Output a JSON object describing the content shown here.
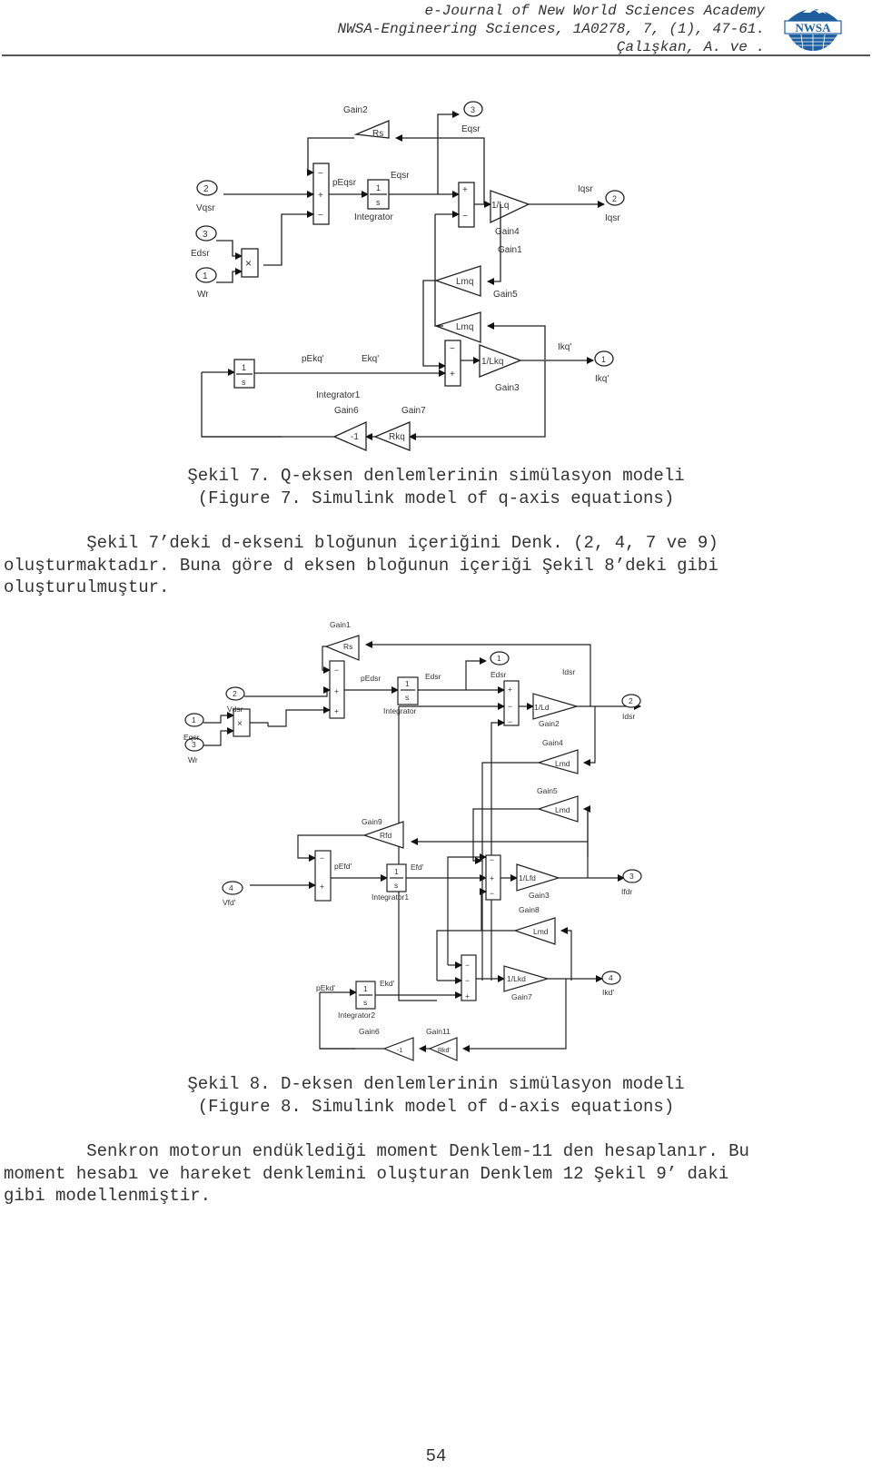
{
  "header": {
    "journal": "e-Journal of New World Sciences Academy",
    "citation": "NWSA-Engineering Sciences, 1A0278, 7, (1), 47-61.",
    "authors": "Çalışkan, A. ve .",
    "logo_text": "NWSA"
  },
  "figure7": {
    "caption_tr": "Şekil 7. Q-eksen denlemlerinin simülasyon modeli",
    "caption_en": "(Figure 7. Simulink model of q-axis equations)",
    "labels": {
      "gain2": "Gain2",
      "rs": "Rs",
      "in2_num": "2",
      "in2": "Vqsr",
      "in3_num": "3",
      "in3": "Edsr",
      "in1_num": "1",
      "in1": "Wr",
      "product": "×",
      "pEqsr": "pEqsr",
      "eqsr": "Eqsr",
      "int_num": "1",
      "int_den": "s",
      "integrator": "Integrator",
      "out3_num": "3",
      "out3": "Eqsr",
      "gain4_val": "1/Lq",
      "gain4": "Gain4",
      "iqsr": "Iqsr",
      "out2_num": "2",
      "out2": "Iqsr",
      "gain1": "Gain1",
      "lmq1": "Lmq",
      "gain5": "Gain5",
      "lmq2": "Lmq",
      "pEkq": "pEkq'",
      "ekq": "Ekq'",
      "integrator1": "Integrator1",
      "gain3_val": "1/Lkq",
      "gain3": "Gain3",
      "ikq": "Ikq'",
      "out1_num": "1",
      "out1": "Ikq'",
      "gain6": "Gain6",
      "neg1": "-1",
      "gain7": "Gain7",
      "rkq": "Rkq",
      "plus": "+",
      "minus": "−"
    }
  },
  "paragraph1": "        Şekil 7’deki d-ekseni bloğunun içeriğini Denk. (2, 4, 7 ve 9)\noluşturmaktadır. Buna göre d eksen bloğunun içeriği Şekil 8’deki gibi\noluşturulmuştur.",
  "figure8": {
    "caption_tr": "Şekil 8. D-eksen denlemlerinin simülasyon modeli",
    "caption_en": "(Figure 8. Simulink model of d-axis equations)",
    "labels": {
      "gain1": "Gain1",
      "rs": "Rs",
      "in2_num": "2",
      "in2": "Vdsr",
      "in1_num": "1",
      "in1": "Eqsr",
      "in3_num": "3",
      "in3": "Wr",
      "product": "×",
      "pEdsr": "pEdsr",
      "edsr": "Edsr",
      "int_num": "1",
      "int_den": "s",
      "integrator": "Integrator",
      "out1_num": "1",
      "out1": "Edsr",
      "idsr": "Idsr",
      "gain2_val": "1/Ld",
      "gain2": "Gain2",
      "out2_num": "2",
      "out2": "Idsr",
      "gain4": "Gain4",
      "lmd4": "Lmd",
      "gain5": "Gain5",
      "lmd5": "Lmd",
      "gain9": "Gain9",
      "rfd": "Rfd",
      "in4_num": "4",
      "in4": "Vfd'",
      "pEfd": "pEfd'",
      "efd": "Efd'",
      "integrator1": "Integrator1",
      "gain3_val": "1/Lfd",
      "gain3": "Gain3",
      "out3_num": "3",
      "out3": "Ifdr",
      "gain8": "Gain8",
      "lmd8": "Lmd",
      "gain7_val": "1/Lkd",
      "gain7": "Gain7",
      "out4_num": "4",
      "out4": "Ikd'",
      "pEkd": "pEkd'",
      "ekd": "Ekd'",
      "integrator2": "Integrator2",
      "gain6": "Gain6",
      "neg1": "-1",
      "gain11": "Gain11",
      "rkd": "Rkd'",
      "plus": "+",
      "minus": "−"
    }
  },
  "paragraph2": "        Senkron motorun endüklediği moment Denklem-11 den hesaplanır. Bu\nmoment hesabı ve hareket denklemini oluşturan Denklem 12 Şekil 9’ daki\ngibi modellenmiştir.",
  "page_number": "54"
}
